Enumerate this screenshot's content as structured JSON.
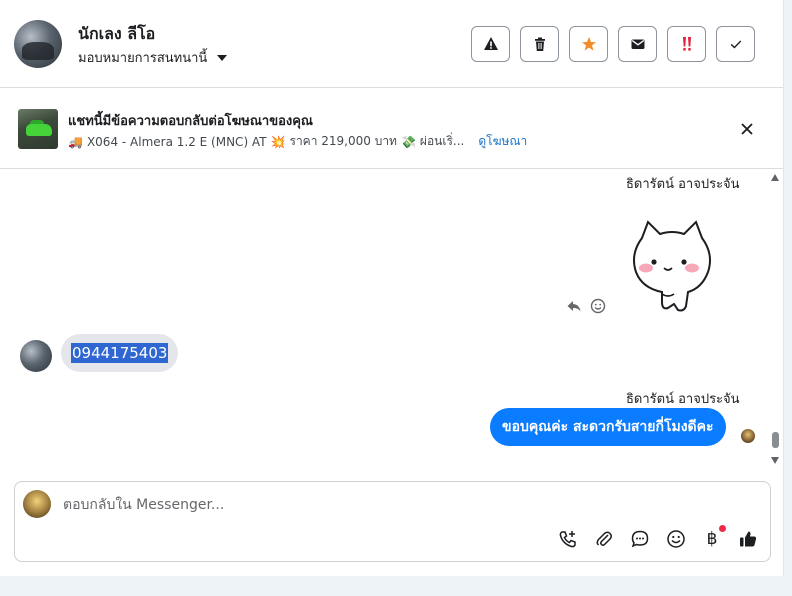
{
  "header": {
    "contact_name": "นักเลง ลีโอ",
    "assign_label": "มอบหมายการสนทนานี้",
    "buttons": [
      {
        "name": "spam-button",
        "icon": "warning-icon",
        "color": "#1c1e21"
      },
      {
        "name": "delete-button",
        "icon": "trash-icon",
        "color": "#1c1e21"
      },
      {
        "name": "star-button",
        "icon": "star-icon",
        "color": "#f28c28"
      },
      {
        "name": "mark-unread-button",
        "icon": "mail-icon",
        "color": "#1c1e21"
      },
      {
        "name": "follow-up-button",
        "icon": "double-exclamation-icon",
        "color": "#e41e3f"
      },
      {
        "name": "done-button",
        "icon": "check-icon",
        "color": "#1c1e21"
      }
    ]
  },
  "ad": {
    "title": "แชทนี้มีข้อความตอบกลับต่อโฆษณาของคุณ",
    "truck_emoji": "🚚",
    "description": "X064 - Almera 1.2 E (MNC) AT",
    "boom_emoji": "💥",
    "price": "ราคา 219,000 บาท",
    "money_emoji": "💸",
    "installment": "ผ่อนเริ่...",
    "link": "ดูโฆษณา"
  },
  "conversation": {
    "sender_1": "ธิดารัตน์ อาจประจัน",
    "incoming_message": "0944175403",
    "sender_2": "ธิดารัตน์ อาจประจัน",
    "outgoing_message": "ขอบคุณค่ะ สะดวกรับสายกี่โมงดีคะ"
  },
  "composer": {
    "placeholder": "ตอบกลับใน Messenger...",
    "baht_symbol": "฿"
  },
  "colors": {
    "accent": "#0a7cff",
    "link": "#1a73c8",
    "selection": "#2f66d1"
  }
}
